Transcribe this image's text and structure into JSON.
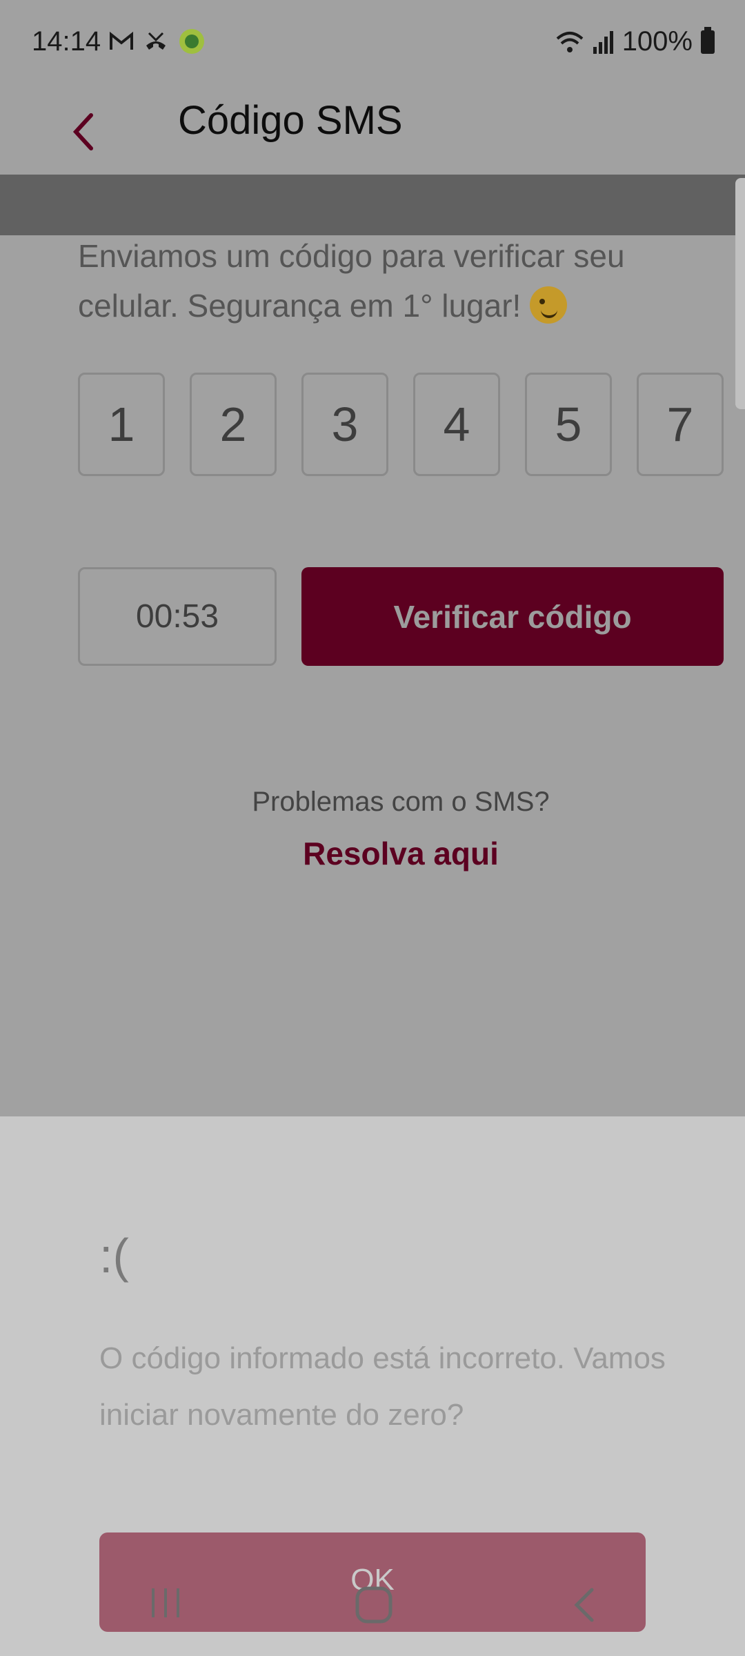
{
  "status_bar": {
    "time": "14:14",
    "battery": "100%",
    "icons": [
      "gmail-icon",
      "missed-call-icon",
      "app-badge-icon",
      "wifi-icon",
      "signal-icon",
      "battery-icon"
    ]
  },
  "app_bar": {
    "title": "Código SMS",
    "back_icon": "chevron-left-icon"
  },
  "intro_text": "Enviamos um código para verificar seu celular. Segurança em 1° lugar!",
  "intro_emoji": "winking-face-icon",
  "code_digits": [
    "1",
    "2",
    "3",
    "4",
    "5",
    "7"
  ],
  "timer": "00:53",
  "verify_button": "Verificar código",
  "help": {
    "question": "Problemas com o SMS?",
    "link": "Resolva aqui"
  },
  "error_sheet": {
    "face": ":(",
    "message": "O código informado está incorreto. Vamos iniciar novamente do zero?",
    "ok_button": "OK"
  },
  "nav_bar": {
    "icons": [
      "recent-apps-icon",
      "home-icon",
      "back-icon"
    ]
  },
  "colors": {
    "brand": "#5c0020",
    "scrim": "#a1a1a1",
    "sheet": "#c8c8c8",
    "ok_button": "#9c5a6b"
  }
}
